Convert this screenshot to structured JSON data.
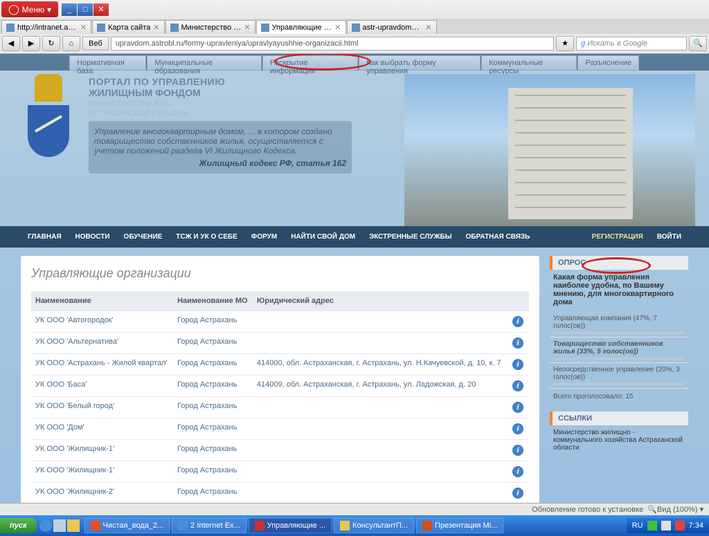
{
  "browser": {
    "menu_label": "Меню",
    "web_label": "Веб",
    "url": "upravdom.astrobl.ru/formy-upravleniya/upravlyayushhie-organizacii.html",
    "search_placeholder": "Искать в Google",
    "tabs": [
      {
        "label": "http://intranet.astr..."
      },
      {
        "label": "Карта сайта"
      },
      {
        "label": "Министерство жи..."
      },
      {
        "label": "Управляющие орг...",
        "active": true
      },
      {
        "label": "astr-upravdom@m..."
      }
    ]
  },
  "top_nav": [
    "Нормативная база",
    "Муниципальные образования",
    "Раскрытие информации",
    "Как выбрать форму управления",
    "Коммунальные ресурсы",
    "Разъяснение"
  ],
  "header": {
    "line1": "ПОРТАЛ ПО УПРАВЛЕНИЮ",
    "line2": "ЖИЛИЩНЫМ ФОНДОМ",
    "ministry1": "МИНИСТЕРСТВА ЖКХ",
    "ministry2": "АСТРАХАНСКОЙ ОБЛАСТИ",
    "quote": "Управление многоквартирным домом, ... в котором создано товарищество собственников жилья, осуществляется с учетом положений раздела VI Жилищного Кодекса.",
    "quote_ref": "Жилищный кодекс РФ, статья 162"
  },
  "main_nav": [
    "ГЛАВНАЯ",
    "НОВОСТИ",
    "ОБУЧЕНИЕ",
    "ТСЖ И УК О СЕБЕ",
    "ФОРУМ",
    "НАЙТИ СВОЙ ДОМ",
    "ЭКСТРЕННЫЕ СЛУЖБЫ",
    "ОБРАТНАЯ СВЯЗЬ"
  ],
  "main_nav_right": [
    "РЕГИСТРАЦИЯ",
    "ВОЙТИ"
  ],
  "page_title": "Управляющие организации",
  "table": {
    "headers": [
      "Наименование",
      "Наименование МО",
      "Юридический адрес"
    ],
    "rows": [
      {
        "name": "УК ООО 'Автогородок'",
        "mo": "Город Астрахань",
        "addr": ""
      },
      {
        "name": "УК ООО 'Альтернатива'",
        "mo": "Город Астрахань",
        "addr": ""
      },
      {
        "name": "УК ООО 'Астрахань - Жилой квартал'",
        "mo": "Город Астрахань",
        "addr": "414000, обл. Астраханская, г. Астрахань, ул. Н.Качуевской, д. 10, к. 7"
      },
      {
        "name": "УК ООО 'Баса'",
        "mo": "Город Астрахань",
        "addr": "414009, обл. Астраханская, г. Астрахань, ул. Ладожская, д. 20"
      },
      {
        "name": "УК ООО 'Белый город'",
        "mo": "Город Астрахань",
        "addr": ""
      },
      {
        "name": "УК ООО 'Дом'",
        "mo": "Город Астрахань",
        "addr": ""
      },
      {
        "name": "УК ООО 'Жилищник-1'",
        "mo": "Город Астрахань",
        "addr": ""
      },
      {
        "name": "УК ООО 'Жилищник-1'",
        "mo": "Город Астрахань",
        "addr": ""
      },
      {
        "name": "УК ООО 'Жилищник-2'",
        "mo": "Город Астрахань",
        "addr": ""
      }
    ]
  },
  "sidebar": {
    "poll_header": "ОПРОС",
    "poll_q": "Какая форма управления наиболее удобна, по Вашему мнению, для многоквартирного дома",
    "options": [
      {
        "text": "Управляющая компания (47%, 7 голос(ов))",
        "sel": false
      },
      {
        "text": "Товарищество собственников жилья (33%, 5 голос(ов))",
        "sel": true
      },
      {
        "text": "Непосредственное управление (20%, 3 голос(ов))",
        "sel": false
      }
    ],
    "total": "Всего проголосовало: 15",
    "links_header": "ССЫЛКИ",
    "link1": "Министерство жилищно - коммунального хозяйства Астраханской области"
  },
  "status": {
    "update_text": "Обновление готово к установке",
    "zoom": "Вид (100%)"
  },
  "taskbar": {
    "start": "пуск",
    "items": [
      "Чистая_вода_2...",
      "2 Internet Ex...",
      "Управляющие ...",
      "КонсультантП...",
      "Презентация Mi..."
    ],
    "lang": "RU",
    "time": "7:34"
  }
}
